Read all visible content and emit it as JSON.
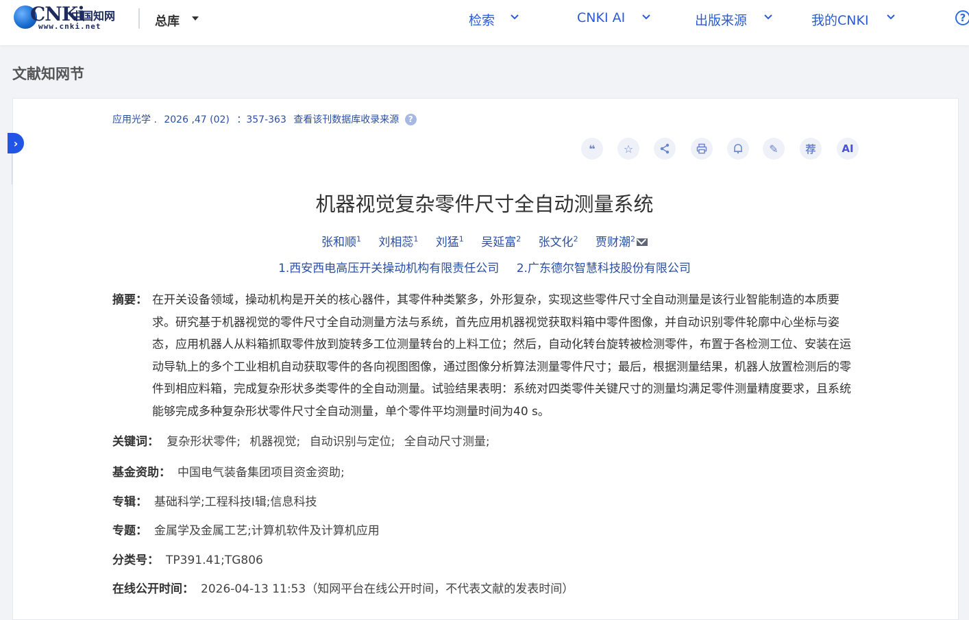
{
  "header": {
    "logo_text": "CNKi",
    "logo_cn": "中国知网",
    "logo_url": "www.cnki.net",
    "library_dropdown": "总库",
    "nav": [
      {
        "label": "检索"
      },
      {
        "label": "CNKI AI"
      },
      {
        "label": "出版来源"
      },
      {
        "label": "我的CNKI"
      }
    ],
    "help_icon": "?"
  },
  "section_title": "文献知网节",
  "side_toggle": "›",
  "source": {
    "journal": "应用光学 .",
    "issue": "2026 ,47 (02)",
    "pages": "：357-363",
    "link": "查看该刊数据库收录来源",
    "help": "?"
  },
  "toolbar": [
    {
      "name": "cite-icon",
      "glyph": "❝"
    },
    {
      "name": "star-icon",
      "glyph": "☆"
    },
    {
      "name": "share-icon",
      "glyph": "⋖"
    },
    {
      "name": "print-icon",
      "glyph": "⎙"
    },
    {
      "name": "bell-icon",
      "glyph": "🔔"
    },
    {
      "name": "edit-icon",
      "glyph": "✎"
    },
    {
      "name": "recommend-icon",
      "glyph": "荐"
    },
    {
      "name": "ai-icon",
      "glyph": "AI"
    }
  ],
  "article": {
    "title": "机器视觉复杂零件尺寸全自动测量系统",
    "authors": [
      {
        "name": "张和顺",
        "sup": "1"
      },
      {
        "name": "刘相蕊",
        "sup": "1"
      },
      {
        "name": "刘猛",
        "sup": "1"
      },
      {
        "name": "吴延富",
        "sup": "2"
      },
      {
        "name": "张文化",
        "sup": "2"
      },
      {
        "name": "贾财潮",
        "sup": "2"
      }
    ],
    "orgs": [
      "1.西安西电高压开关操动机构有限责任公司",
      "2.广东德尔智慧科技股份有限公司"
    ],
    "abstract_label": "摘要：",
    "abstract": "在开关设备领域，操动机构是开关的核心器件，其零件种类繁多，外形复杂，实现这些零件尺寸全自动测量是该行业智能制造的本质要求。研究基于机器视觉的零件尺寸全自动测量方法与系统，首先应用机器视觉获取料箱中零件图像，并自动识别零件轮廓中心坐标与姿态，应用机器人从料箱抓取零件放到旋转多工位测量转台的上料工位；然后，自动化转台旋转被检测零件，布置于各检测工位、安装在运动导轨上的多个工业相机自动获取零件的各向视图图像，通过图像分析算法测量零件尺寸；最后，根据测量结果，机器人放置检测后的零件到相应料箱，完成复杂形状多类零件的全自动测量。试验结果表明：系统对四类零件关键尺寸的测量均满足零件测量精度要求，且系统能够完成多种复杂形状零件尺寸全自动测量，单个零件平均测量时间为40 s。",
    "keywords_label": "关键词：",
    "keywords": [
      "复杂形状零件;",
      "机器视觉;",
      "自动识别与定位;",
      "全自动尺寸测量;"
    ],
    "fund_label": "基金资助：",
    "fund": "中国电气装备集团项目资金资助;",
    "series_label": "专辑：",
    "series": "基础科学;工程科技Ⅰ辑;信息科技",
    "topic_label": "专题：",
    "topic": "金属学及金属工艺;计算机软件及计算机应用",
    "class_label": "分类号：",
    "class": "TP391.41;TG806",
    "online_label": "在线公开时间：",
    "online": "2026-04-13 11:53（知网平台在线公开时间，不代表文献的发表时间）"
  }
}
